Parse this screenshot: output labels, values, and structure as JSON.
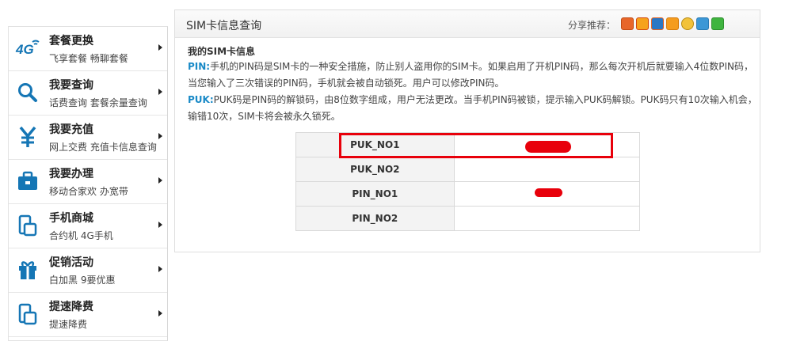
{
  "sidebar": {
    "items": [
      {
        "title": "套餐更换",
        "sub": "飞享套餐 畅聊套餐",
        "icon": "4g-icon"
      },
      {
        "title": "我要查询",
        "sub": "话费查询 套餐余量查询",
        "icon": "search-icon"
      },
      {
        "title": "我要充值",
        "sub": "网上交费 充值卡信息查询",
        "icon": "yen-icon"
      },
      {
        "title": "我要办理",
        "sub": "移动合家欢 办宽带",
        "icon": "briefcase-icon"
      },
      {
        "title": "手机商城",
        "sub": "合约机 4G手机",
        "icon": "phone-icon"
      },
      {
        "title": "促销活动",
        "sub": "白加黑 9要优惠",
        "icon": "gift-icon"
      },
      {
        "title": "提速降费",
        "sub": "提速降费",
        "icon": "phone-icon"
      }
    ]
  },
  "panel": {
    "title": "SIM卡信息查询",
    "share_label": "分享推荐：",
    "share_icons": [
      "qzone-icon",
      "tencent-weibo-icon",
      "renren-icon",
      "kaixin-icon",
      "sina-weibo-icon",
      "douban-icon",
      "more-share-icon"
    ],
    "section_title": "我的SIM卡信息",
    "pin_key": "PIN:",
    "pin_line1": "手机的PIN码是SIM卡的一种安全措施，防止别人盗用你的SIM卡。如果启用了开机PIN码，那么每次开机后就要输入4位数PIN码，",
    "pin_line2": "当您输入了三次错误的PIN码，手机就会被自动锁死。用户可以修改PIN码。",
    "puk_key": "PUK:",
    "puk_line1": "PUK码是PIN码的解锁码，由8位数字组成，用户无法更改。当手机PIN码被锁，提示输入PUK码解锁。PUK码只有10次输入机会，",
    "puk_line2": "输错10次，SIM卡将会被永久锁死。"
  },
  "table": {
    "rows": [
      {
        "label": "PUK_NO1",
        "value": ""
      },
      {
        "label": "PUK_NO2",
        "value": ""
      },
      {
        "label": "PIN_NO1",
        "value": ""
      },
      {
        "label": "PIN_NO2",
        "value": ""
      }
    ]
  },
  "colors": {
    "accent": "#1a8ac7",
    "highlight": "#e8000b",
    "icon_blue": "#1576b5"
  }
}
